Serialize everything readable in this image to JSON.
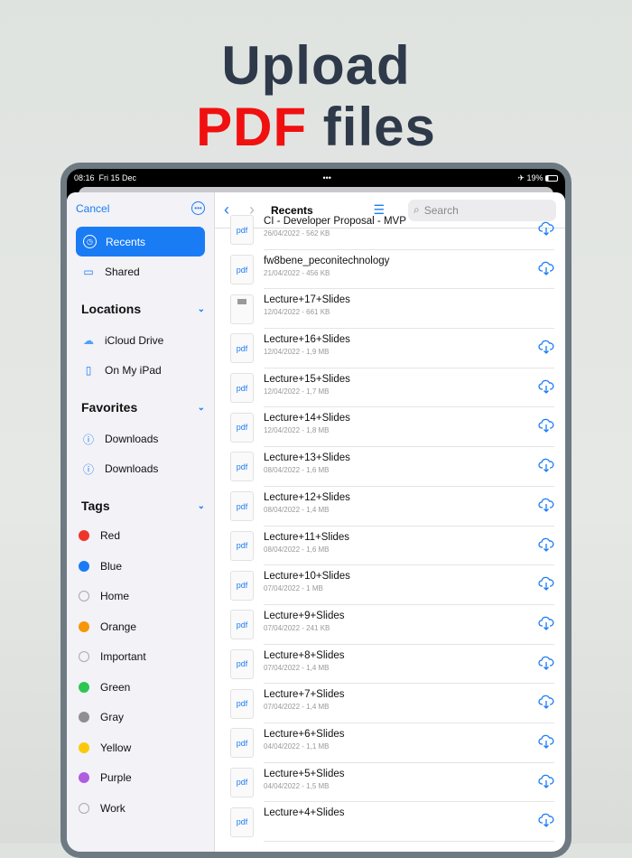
{
  "headline": {
    "line1": "Upload",
    "accent": "PDF",
    "rest": "files"
  },
  "status": {
    "time": "08:16",
    "date": "Fri 15 Dec",
    "battery": "19%"
  },
  "sidebar": {
    "cancel": "Cancel",
    "recents": "Recents",
    "shared": "Shared",
    "locations": {
      "title": "Locations",
      "items": [
        "iCloud Drive",
        "On My iPad"
      ]
    },
    "favorites": {
      "title": "Favorites",
      "items": [
        "Downloads",
        "Downloads"
      ]
    },
    "tags": {
      "title": "Tags",
      "items": [
        {
          "label": "Red",
          "color": "#f0342c"
        },
        {
          "label": "Blue",
          "color": "#1a7cf5"
        },
        {
          "label": "Home",
          "color": ""
        },
        {
          "label": "Orange",
          "color": "#f7960b"
        },
        {
          "label": "Important",
          "color": ""
        },
        {
          "label": "Green",
          "color": "#2dc653"
        },
        {
          "label": "Gray",
          "color": "#8e8e93"
        },
        {
          "label": "Yellow",
          "color": "#fcc90a"
        },
        {
          "label": "Purple",
          "color": "#b05ce0"
        },
        {
          "label": "Work",
          "color": ""
        }
      ]
    }
  },
  "toolbar": {
    "title": "Recents",
    "search_placeholder": "Search"
  },
  "files": [
    {
      "name": "CI - Developer Proposal - MVP",
      "meta": "26/04/2022 - 562 KB",
      "thumb": "pdf",
      "cloud": true
    },
    {
      "name": "fw8bene_peconitechnology",
      "meta": "21/04/2022 - 456 KB",
      "thumb": "pdf",
      "cloud": true
    },
    {
      "name": "Lecture+17+Slides",
      "meta": "12/04/2022 - 661 KB",
      "thumb": "",
      "cloud": false
    },
    {
      "name": "Lecture+16+Slides",
      "meta": "12/04/2022 - 1,9 MB",
      "thumb": "pdf",
      "cloud": true
    },
    {
      "name": "Lecture+15+Slides",
      "meta": "12/04/2022 - 1,7 MB",
      "thumb": "pdf",
      "cloud": true
    },
    {
      "name": "Lecture+14+Slides",
      "meta": "12/04/2022 - 1,8 MB",
      "thumb": "pdf",
      "cloud": true
    },
    {
      "name": "Lecture+13+Slides",
      "meta": "08/04/2022 - 1,6 MB",
      "thumb": "pdf",
      "cloud": true
    },
    {
      "name": "Lecture+12+Slides",
      "meta": "08/04/2022 - 1,4 MB",
      "thumb": "pdf",
      "cloud": true
    },
    {
      "name": "Lecture+11+Slides",
      "meta": "08/04/2022 - 1,6 MB",
      "thumb": "pdf",
      "cloud": true
    },
    {
      "name": "Lecture+10+Slides",
      "meta": "07/04/2022 - 1 MB",
      "thumb": "pdf",
      "cloud": true
    },
    {
      "name": "Lecture+9+Slides",
      "meta": "07/04/2022 - 241 KB",
      "thumb": "pdf",
      "cloud": true
    },
    {
      "name": "Lecture+8+Slides",
      "meta": "07/04/2022 - 1,4 MB",
      "thumb": "pdf",
      "cloud": true
    },
    {
      "name": "Lecture+7+Slides",
      "meta": "07/04/2022 - 1,4 MB",
      "thumb": "pdf",
      "cloud": true
    },
    {
      "name": "Lecture+6+Slides",
      "meta": "04/04/2022 - 1,1 MB",
      "thumb": "pdf",
      "cloud": true
    },
    {
      "name": "Lecture+5+Slides",
      "meta": "04/04/2022 - 1,5 MB",
      "thumb": "pdf",
      "cloud": true
    },
    {
      "name": "Lecture+4+Slides",
      "meta": "",
      "thumb": "pdf",
      "cloud": true
    }
  ]
}
